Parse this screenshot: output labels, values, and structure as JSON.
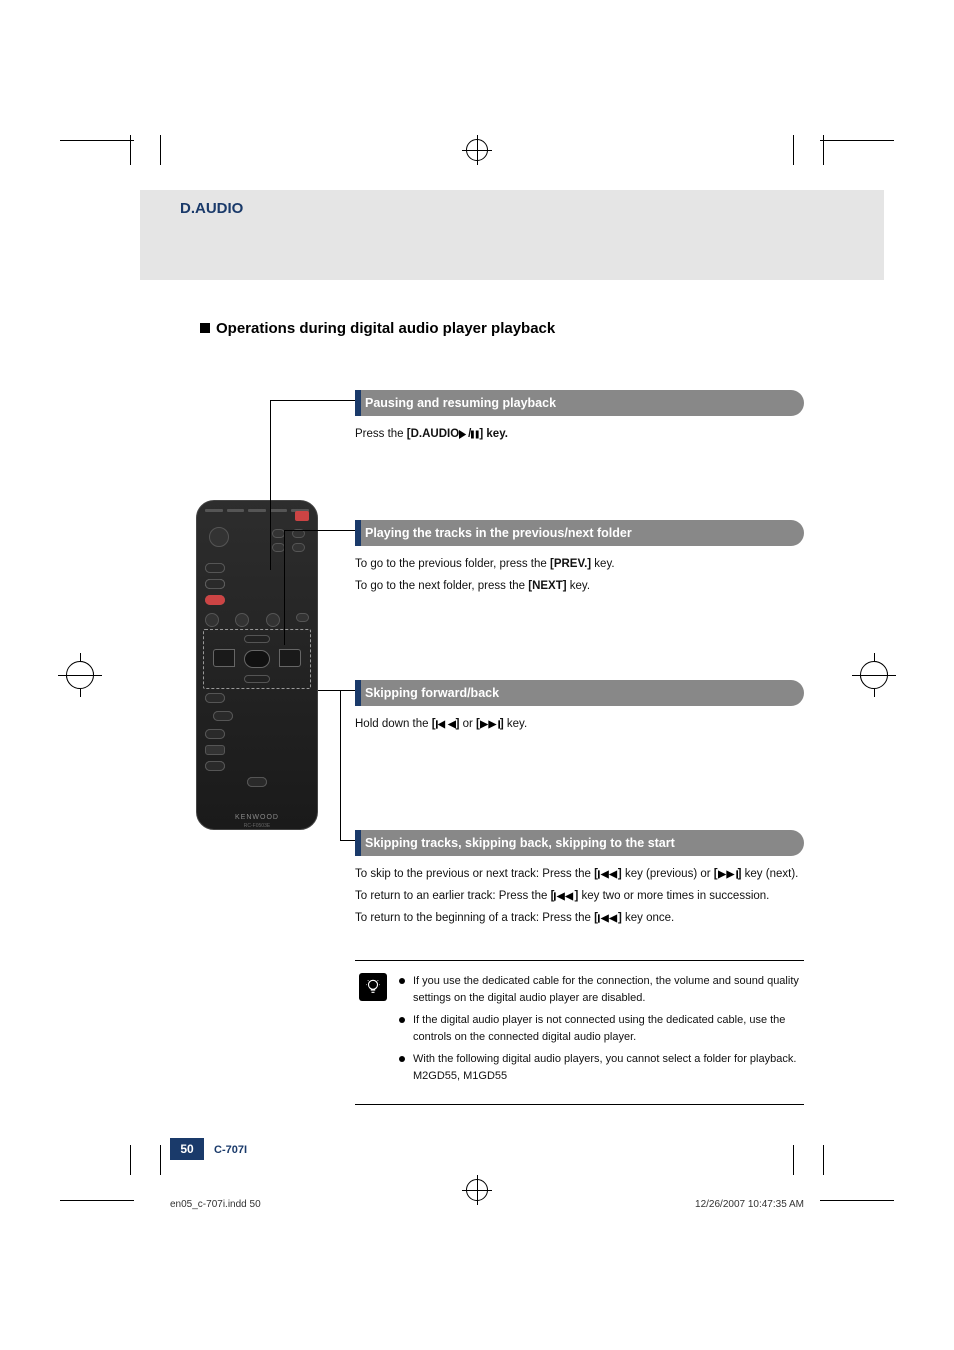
{
  "header": {
    "section": "D.AUDIO"
  },
  "heading": "Operations during digital audio player playback",
  "sections": {
    "pause": {
      "title": "Pausing and resuming playback",
      "text_pre": "Press the ",
      "key": "[D.AUDIO",
      "text_post": "] key."
    },
    "folder": {
      "title": "Playing the tracks in the previous/next folder",
      "line1_pre": "To go to the previous folder, press the ",
      "line1_key": "[PREV.]",
      "line1_post": " key.",
      "line2_pre": "To go to the next folder, press the ",
      "line2_key": "[NEXT]",
      "line2_post": " key."
    },
    "skipfb": {
      "title": "Skipping forward/back",
      "text_pre": "Hold down the ",
      "mid": " or ",
      "text_post": " key."
    },
    "skiptrack": {
      "title": "Skipping tracks, skipping back, skipping to the start",
      "l1a": "To skip to the previous or next track: Press the ",
      "l1b": " key (previous) or ",
      "l1c": " key (next).",
      "l2a": "To return to an earlier track: Press the ",
      "l2b": " key two or more times in succession.",
      "l3a": "To return to the beginning of a track: Press the ",
      "l3b": " key once."
    }
  },
  "notes": [
    "If you use the dedicated cable for the connection, the volume and sound quality settings on the digital audio player are disabled.",
    "If the digital audio player is not connected using the dedicated cable, use the controls on the connected digital audio player.",
    "With the following digital audio players, you cannot select a folder for playback. M2GD55, M1GD55"
  ],
  "remote": {
    "brand": "KENWOOD",
    "model": "RC-F0503E"
  },
  "footer": {
    "page": "50",
    "model": "C-707I",
    "indd": "en05_c-707i.indd   50",
    "timestamp": "12/26/2007   10:47:35 AM"
  }
}
